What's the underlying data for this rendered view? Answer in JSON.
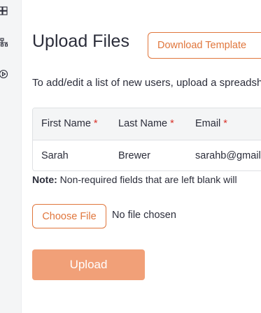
{
  "sidebar": {
    "icons": [
      "boxes-icon",
      "hierarchy-icon",
      "play-circle-icon"
    ]
  },
  "page": {
    "title": "Upload Files",
    "download_template_label": "Download Template",
    "instructions": "To add/edit a list of new users, upload a spreadsheet"
  },
  "table": {
    "columns": [
      {
        "label": "First Name",
        "required": "*"
      },
      {
        "label": "Last Name",
        "required": "*"
      },
      {
        "label": "Email",
        "required": "*"
      }
    ],
    "rows": [
      [
        "Sarah",
        "Brewer",
        "sarahb@gmail.com"
      ]
    ]
  },
  "note": {
    "label": "Note:",
    "text": "Non-required fields that are left blank will"
  },
  "file_input": {
    "button_label": "Choose File",
    "status": "No file chosen"
  },
  "upload": {
    "label": "Upload"
  },
  "colors": {
    "accent": "#e0763c",
    "upload_disabled": "#f1a078",
    "required": "#d9332b",
    "rail_bg": "#f4f5f6"
  }
}
